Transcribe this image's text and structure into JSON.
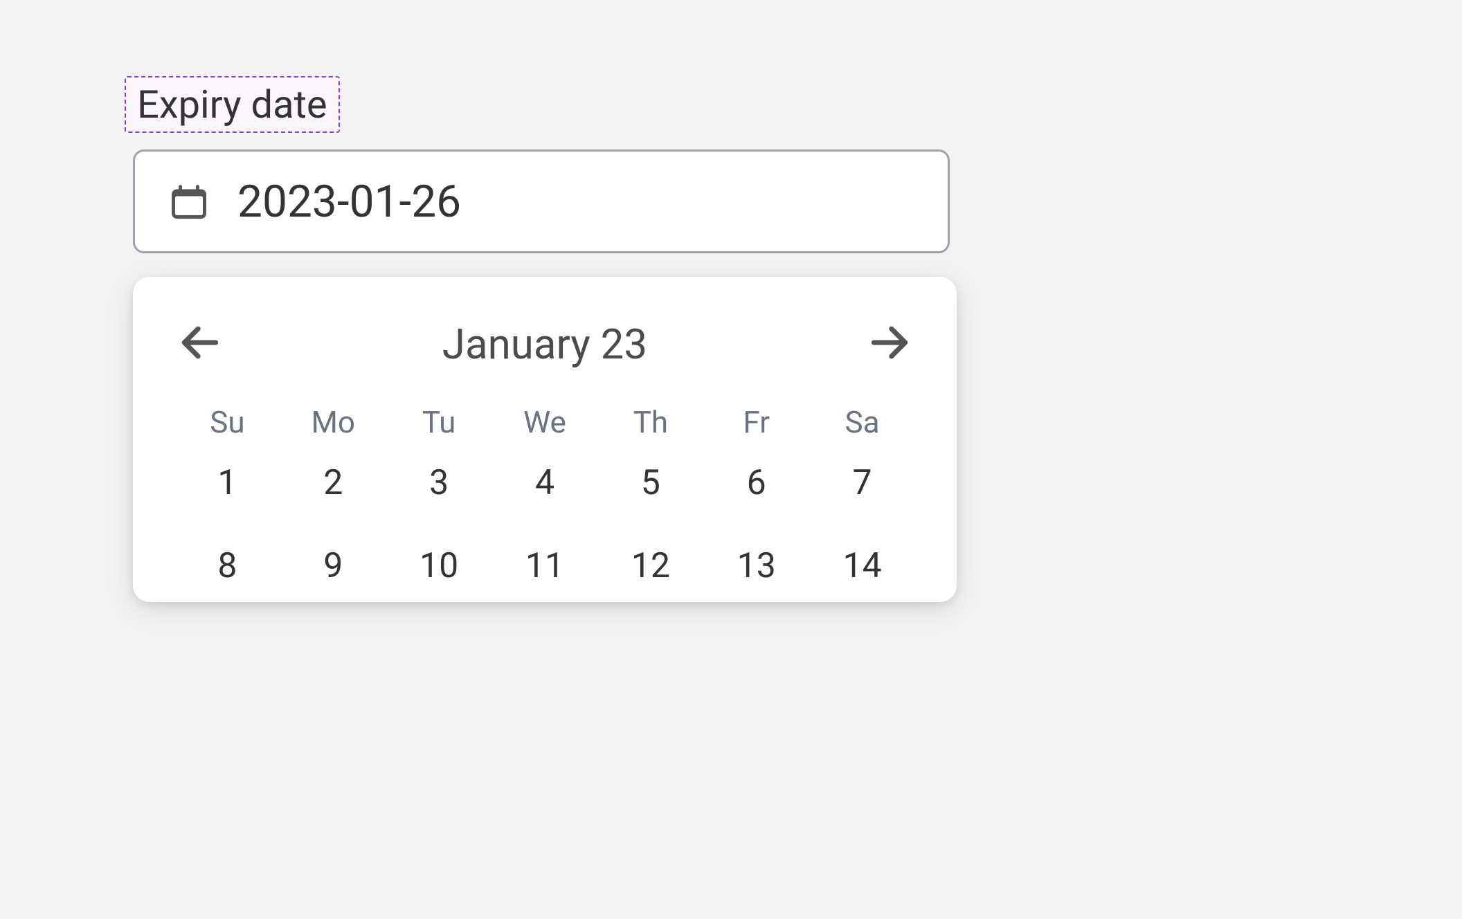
{
  "field": {
    "label": "Expiry date",
    "value": "2023-01-26"
  },
  "calendar": {
    "month_year": "January 23",
    "weekdays": [
      "Su",
      "Mo",
      "Tu",
      "We",
      "Th",
      "Fr",
      "Sa"
    ],
    "days_row1": [
      "1",
      "2",
      "3",
      "4",
      "5",
      "6",
      "7"
    ],
    "days_row2": [
      "8",
      "9",
      "10",
      "11",
      "12",
      "13",
      "14"
    ]
  }
}
